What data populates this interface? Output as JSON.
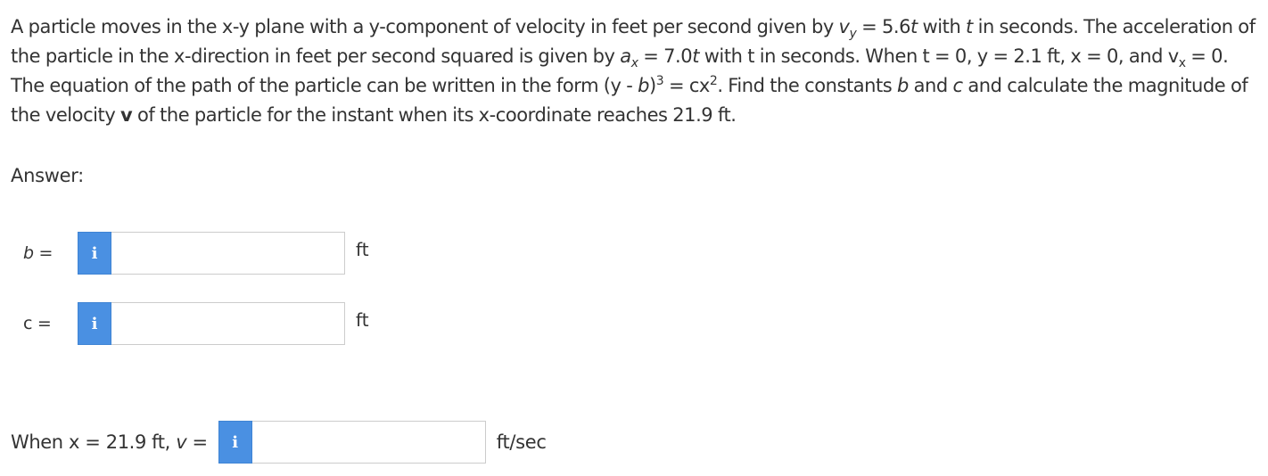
{
  "question": {
    "t1": "A particle moves in the x-y plane with a y-component of velocity in feet per second given by ",
    "vy_v": "v",
    "vy_sub": "y",
    "t2": " = 5.6",
    "t_var": "t",
    "t3": " with ",
    "t4": " in seconds. The acceleration of the particle in the x-direction in feet per second squared is given by ",
    "ax_a": "a",
    "ax_sub": "x",
    "t5": " = 7.0",
    "t6": " with t in seconds. When t = 0, y = 2.1 ft, x = 0, and v",
    "vx_sub": "x",
    "t7": " = 0. The equation of the path of the particle can be written in the form (y - ",
    "b_var": "b",
    "t8": ")",
    "sup3": "3",
    "t9": " = cx",
    "sup2": "2",
    "t10": ". Find the constants ",
    "t11": " and ",
    "c_var": "c",
    "t12": " and calculate the magnitude of the velocity ",
    "v_bold": "v",
    "t13": " of the particle for the instant when its x-coordinate reaches 21.9 ft."
  },
  "answer_label": "Answer:",
  "fields": {
    "b": {
      "label_var": "b",
      "label_eq": " =",
      "info": "i",
      "value": "",
      "placeholder": "",
      "unit": "ft"
    },
    "c": {
      "label": "c =",
      "info": "i",
      "value": "",
      "placeholder": "",
      "unit": "ft"
    },
    "v": {
      "label_pre": "When x = 21.9 ft, ",
      "label_var": "v",
      "label_eq": " =",
      "info": "i",
      "value": "",
      "placeholder": "",
      "unit": "ft/sec"
    }
  },
  "colors": {
    "info_button": "#4a90e2",
    "text": "#333333",
    "input_border": "#cccccc"
  },
  "icons": {
    "info": "info-icon"
  }
}
